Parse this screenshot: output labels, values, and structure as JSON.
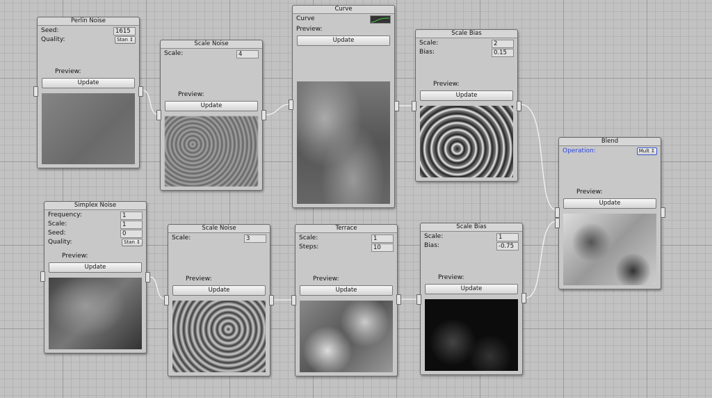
{
  "common": {
    "preview": "Preview:",
    "update": "Update"
  },
  "perlin": {
    "title": "Perlin Noise",
    "seed_label": "Seed:",
    "seed": "1615",
    "quality_label": "Quality:",
    "quality": "Stan"
  },
  "scale_noise_1": {
    "title": "Scale Noise",
    "scale_label": "Scale:",
    "scale": "4"
  },
  "curve": {
    "title": "Curve",
    "curve_label": "Curve"
  },
  "scale_bias_1": {
    "title": "Scale Bias",
    "scale_label": "Scale:",
    "scale": "2",
    "bias_label": "Bias:",
    "bias": "0.15"
  },
  "blend": {
    "title": "Blend",
    "operation_label": "Operation:",
    "operation": "Mult"
  },
  "simplex": {
    "title": "Simplex Noise",
    "frequency_label": "Frequency:",
    "frequency": "1",
    "scale_label": "Scale:",
    "scale": "1",
    "seed_label": "Seed:",
    "seed": "0",
    "quality_label": "Quality:",
    "quality": "Stan"
  },
  "scale_noise_2": {
    "title": "Scale Noise",
    "scale_label": "Scale:",
    "scale": "3"
  },
  "terrace": {
    "title": "Terrace",
    "scale_label": "Scale:",
    "scale": "1",
    "steps_label": "Steps:",
    "steps": "10"
  },
  "scale_bias_2": {
    "title": "Scale Bias",
    "scale_label": "Scale:",
    "scale": "1",
    "bias_label": "Bias:",
    "bias": "-0.75"
  }
}
